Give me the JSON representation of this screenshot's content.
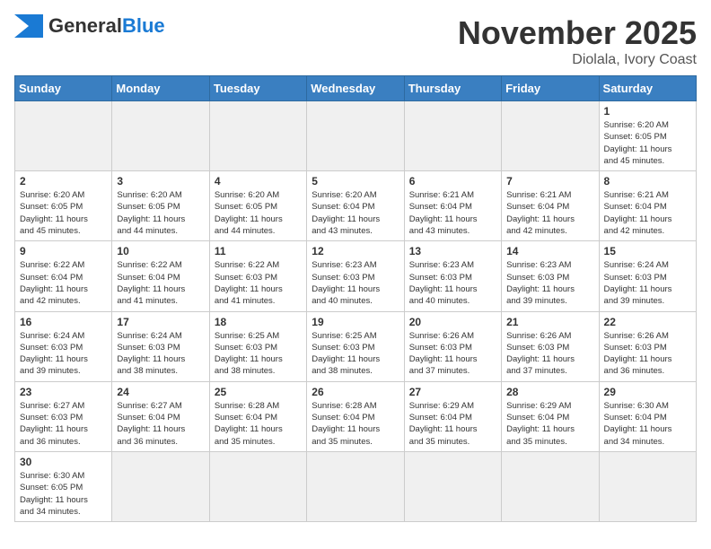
{
  "header": {
    "month_year": "November 2025",
    "location": "Diolala, Ivory Coast",
    "logo_general": "General",
    "logo_blue": "Blue"
  },
  "weekdays": [
    "Sunday",
    "Monday",
    "Tuesday",
    "Wednesday",
    "Thursday",
    "Friday",
    "Saturday"
  ],
  "days": [
    {
      "date": "",
      "info": ""
    },
    {
      "date": "",
      "info": ""
    },
    {
      "date": "",
      "info": ""
    },
    {
      "date": "",
      "info": ""
    },
    {
      "date": "",
      "info": ""
    },
    {
      "date": "",
      "info": ""
    },
    {
      "date": "1",
      "info": "Sunrise: 6:20 AM\nSunset: 6:05 PM\nDaylight: 11 hours\nand 45 minutes."
    },
    {
      "date": "2",
      "info": "Sunrise: 6:20 AM\nSunset: 6:05 PM\nDaylight: 11 hours\nand 45 minutes."
    },
    {
      "date": "3",
      "info": "Sunrise: 6:20 AM\nSunset: 6:05 PM\nDaylight: 11 hours\nand 44 minutes."
    },
    {
      "date": "4",
      "info": "Sunrise: 6:20 AM\nSunset: 6:05 PM\nDaylight: 11 hours\nand 44 minutes."
    },
    {
      "date": "5",
      "info": "Sunrise: 6:20 AM\nSunset: 6:04 PM\nDaylight: 11 hours\nand 43 minutes."
    },
    {
      "date": "6",
      "info": "Sunrise: 6:21 AM\nSunset: 6:04 PM\nDaylight: 11 hours\nand 43 minutes."
    },
    {
      "date": "7",
      "info": "Sunrise: 6:21 AM\nSunset: 6:04 PM\nDaylight: 11 hours\nand 42 minutes."
    },
    {
      "date": "8",
      "info": "Sunrise: 6:21 AM\nSunset: 6:04 PM\nDaylight: 11 hours\nand 42 minutes."
    },
    {
      "date": "9",
      "info": "Sunrise: 6:22 AM\nSunset: 6:04 PM\nDaylight: 11 hours\nand 42 minutes."
    },
    {
      "date": "10",
      "info": "Sunrise: 6:22 AM\nSunset: 6:04 PM\nDaylight: 11 hours\nand 41 minutes."
    },
    {
      "date": "11",
      "info": "Sunrise: 6:22 AM\nSunset: 6:03 PM\nDaylight: 11 hours\nand 41 minutes."
    },
    {
      "date": "12",
      "info": "Sunrise: 6:23 AM\nSunset: 6:03 PM\nDaylight: 11 hours\nand 40 minutes."
    },
    {
      "date": "13",
      "info": "Sunrise: 6:23 AM\nSunset: 6:03 PM\nDaylight: 11 hours\nand 40 minutes."
    },
    {
      "date": "14",
      "info": "Sunrise: 6:23 AM\nSunset: 6:03 PM\nDaylight: 11 hours\nand 39 minutes."
    },
    {
      "date": "15",
      "info": "Sunrise: 6:24 AM\nSunset: 6:03 PM\nDaylight: 11 hours\nand 39 minutes."
    },
    {
      "date": "16",
      "info": "Sunrise: 6:24 AM\nSunset: 6:03 PM\nDaylight: 11 hours\nand 39 minutes."
    },
    {
      "date": "17",
      "info": "Sunrise: 6:24 AM\nSunset: 6:03 PM\nDaylight: 11 hours\nand 38 minutes."
    },
    {
      "date": "18",
      "info": "Sunrise: 6:25 AM\nSunset: 6:03 PM\nDaylight: 11 hours\nand 38 minutes."
    },
    {
      "date": "19",
      "info": "Sunrise: 6:25 AM\nSunset: 6:03 PM\nDaylight: 11 hours\nand 38 minutes."
    },
    {
      "date": "20",
      "info": "Sunrise: 6:26 AM\nSunset: 6:03 PM\nDaylight: 11 hours\nand 37 minutes."
    },
    {
      "date": "21",
      "info": "Sunrise: 6:26 AM\nSunset: 6:03 PM\nDaylight: 11 hours\nand 37 minutes."
    },
    {
      "date": "22",
      "info": "Sunrise: 6:26 AM\nSunset: 6:03 PM\nDaylight: 11 hours\nand 36 minutes."
    },
    {
      "date": "23",
      "info": "Sunrise: 6:27 AM\nSunset: 6:03 PM\nDaylight: 11 hours\nand 36 minutes."
    },
    {
      "date": "24",
      "info": "Sunrise: 6:27 AM\nSunset: 6:04 PM\nDaylight: 11 hours\nand 36 minutes."
    },
    {
      "date": "25",
      "info": "Sunrise: 6:28 AM\nSunset: 6:04 PM\nDaylight: 11 hours\nand 35 minutes."
    },
    {
      "date": "26",
      "info": "Sunrise: 6:28 AM\nSunset: 6:04 PM\nDaylight: 11 hours\nand 35 minutes."
    },
    {
      "date": "27",
      "info": "Sunrise: 6:29 AM\nSunset: 6:04 PM\nDaylight: 11 hours\nand 35 minutes."
    },
    {
      "date": "28",
      "info": "Sunrise: 6:29 AM\nSunset: 6:04 PM\nDaylight: 11 hours\nand 35 minutes."
    },
    {
      "date": "29",
      "info": "Sunrise: 6:30 AM\nSunset: 6:04 PM\nDaylight: 11 hours\nand 34 minutes."
    },
    {
      "date": "30",
      "info": "Sunrise: 6:30 AM\nSunset: 6:05 PM\nDaylight: 11 hours\nand 34 minutes."
    },
    {
      "date": "",
      "info": ""
    },
    {
      "date": "",
      "info": ""
    },
    {
      "date": "",
      "info": ""
    },
    {
      "date": "",
      "info": ""
    },
    {
      "date": "",
      "info": ""
    },
    {
      "date": "",
      "info": ""
    }
  ]
}
